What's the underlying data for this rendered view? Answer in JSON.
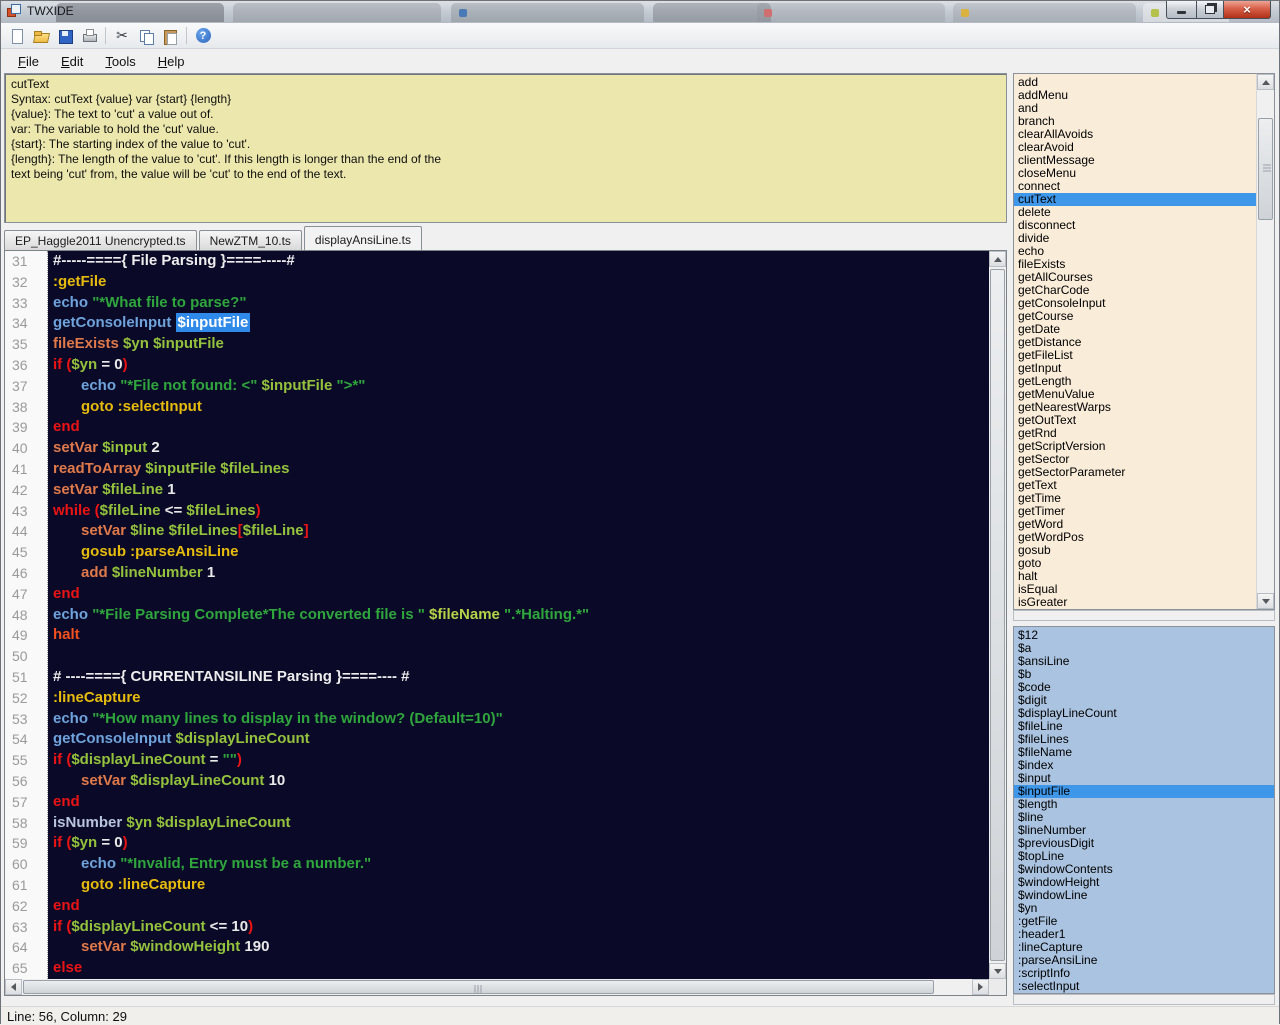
{
  "window": {
    "title": "TWXIDE"
  },
  "colors": {
    "help_bg": "#ece7ac",
    "cmd_bg": "#f9ecd9",
    "var_bg": "#aac3e0",
    "editor_bg": "#0a0a28",
    "row_sel_bg": "#3f97e9",
    "sel_bg": "#2f89e8",
    "sel_fg": "#ffffff",
    "hdr": "#ededed",
    "lbl": "#e7bb0e",
    "cmdB": "#6fa3dc",
    "cmdP": "#b9c4dd",
    "cmdO": "#e0794a",
    "halt": "#f2501e",
    "kw": "#ea1414",
    "var": "#94c23d",
    "varB": "#b6d348",
    "str": "#2fa63c",
    "lit": "#e9e9e9"
  },
  "toolbar": {
    "items": [
      {
        "name": "new-file-button",
        "icon": "new",
        "glyph": ""
      },
      {
        "name": "open-file-button",
        "icon": "open",
        "glyph": ""
      },
      {
        "name": "save-button",
        "icon": "save",
        "glyph": ""
      },
      {
        "name": "print-button",
        "icon": "print",
        "glyph": ""
      },
      {
        "sep": true
      },
      {
        "name": "cut-button",
        "icon": "cut",
        "glyph": "✂"
      },
      {
        "name": "copy-button",
        "icon": "copy",
        "glyph": ""
      },
      {
        "name": "paste-button",
        "icon": "paste",
        "glyph": ""
      },
      {
        "sep": true
      },
      {
        "name": "help-button",
        "icon": "help",
        "glyph": "?"
      }
    ]
  },
  "menu": {
    "items": [
      {
        "label": "File"
      },
      {
        "label": "Edit"
      },
      {
        "label": "Tools"
      },
      {
        "label": "Help"
      }
    ]
  },
  "help_pane": {
    "lines": [
      "cutText",
      "Syntax: cutText {value} var {start} {length}",
      "{value}: The text to 'cut' a value out of.",
      "var: The variable to hold the 'cut' value.",
      "{start}: The starting index of the value to 'cut'.",
      "{length}: The length of the value to 'cut'.  If this length is longer than the end of the",
      "text being 'cut' from, the value will be 'cut' to the end of the text."
    ]
  },
  "tabs": [
    {
      "label": "EP_Haggle2011 Unencrypted.ts",
      "active": false
    },
    {
      "label": "NewZTM_10.ts",
      "active": false
    },
    {
      "label": "displayAnsiLine.ts",
      "active": true
    }
  ],
  "editor": {
    "first_line": 31,
    "lines": [
      {
        "tokens": [
          [
            "hdr",
            "#-----===={ File Parsing }====-----#"
          ]
        ]
      },
      {
        "tokens": [
          [
            "lbl",
            ":getFile"
          ]
        ]
      },
      {
        "tokens": [
          [
            "cmdB",
            "echo "
          ],
          [
            "str",
            "\"*What file to parse?\""
          ]
        ]
      },
      {
        "tokens": [
          [
            "cmdB",
            "getConsoleInput "
          ],
          [
            "sel",
            "$inputFile"
          ]
        ]
      },
      {
        "tokens": [
          [
            "cmdO",
            "fileExists "
          ],
          [
            "var",
            "$yn "
          ],
          [
            "var",
            "$inputFile"
          ]
        ]
      },
      {
        "tokens": [
          [
            "kw",
            "if ("
          ],
          [
            "var",
            "$yn"
          ],
          [
            "lit",
            " = 0"
          ],
          [
            "kw",
            ")"
          ]
        ]
      },
      {
        "tokens": [
          [
            "ind",
            ""
          ],
          [
            "cmdB",
            "echo "
          ],
          [
            "str",
            "\"*File not found: <\" "
          ],
          [
            "var",
            "$inputFile"
          ],
          [
            "str",
            " \">*\""
          ]
        ]
      },
      {
        "tokens": [
          [
            "ind",
            ""
          ],
          [
            "lbl",
            "goto :selectInput"
          ]
        ]
      },
      {
        "tokens": [
          [
            "kw",
            "end"
          ]
        ]
      },
      {
        "tokens": [
          [
            "cmdO",
            "setVar "
          ],
          [
            "var",
            "$input"
          ],
          [
            "lit",
            " 2"
          ]
        ]
      },
      {
        "tokens": [
          [
            "cmdO",
            "readToArray "
          ],
          [
            "var",
            "$inputFile "
          ],
          [
            "var",
            "$fileLines"
          ]
        ]
      },
      {
        "tokens": [
          [
            "cmdO",
            "setVar "
          ],
          [
            "var",
            "$fileLine"
          ],
          [
            "lit",
            " 1"
          ]
        ]
      },
      {
        "tokens": [
          [
            "kw",
            "while ("
          ],
          [
            "var",
            "$fileLine"
          ],
          [
            "lit",
            " <= "
          ],
          [
            "var",
            "$fileLines"
          ],
          [
            "kw",
            ")"
          ]
        ]
      },
      {
        "tokens": [
          [
            "ind",
            ""
          ],
          [
            "cmdO",
            "setVar "
          ],
          [
            "var",
            "$line "
          ],
          [
            "var",
            "$fileLines"
          ],
          [
            "kw",
            "["
          ],
          [
            "var",
            "$fileLine"
          ],
          [
            "kw",
            "]"
          ]
        ]
      },
      {
        "tokens": [
          [
            "ind",
            ""
          ],
          [
            "lbl",
            "gosub :parseAnsiLine"
          ]
        ]
      },
      {
        "tokens": [
          [
            "ind",
            ""
          ],
          [
            "cmdO",
            "add "
          ],
          [
            "var",
            "$lineNumber"
          ],
          [
            "lit",
            " 1"
          ]
        ]
      },
      {
        "tokens": [
          [
            "kw",
            "end"
          ]
        ]
      },
      {
        "tokens": [
          [
            "cmdB",
            "echo "
          ],
          [
            "str",
            "\"*File Parsing Complete*The converted file is \" "
          ],
          [
            "varB",
            "$fileName"
          ],
          [
            "str",
            " \".*Halting.*\""
          ]
        ]
      },
      {
        "tokens": [
          [
            "halt",
            "halt"
          ]
        ]
      },
      {
        "tokens": []
      },
      {
        "tokens": [
          [
            "hdr",
            "# ----===={ CURRENTANSILINE Parsing }====---- #"
          ]
        ]
      },
      {
        "tokens": [
          [
            "lbl",
            ":lineCapture"
          ]
        ]
      },
      {
        "tokens": [
          [
            "cmdB",
            "echo "
          ],
          [
            "str",
            "\"*How many lines to display in the window? (Default=10)\""
          ]
        ]
      },
      {
        "tokens": [
          [
            "cmdB",
            "getConsoleInput "
          ],
          [
            "var",
            "$displayLineCount"
          ]
        ]
      },
      {
        "tokens": [
          [
            "kw",
            "if ("
          ],
          [
            "var",
            "$displayLineCount"
          ],
          [
            "lit",
            " = "
          ],
          [
            "str",
            "\"\""
          ],
          [
            "kw",
            ")"
          ]
        ]
      },
      {
        "tokens": [
          [
            "ind",
            ""
          ],
          [
            "cmdO",
            "setVar "
          ],
          [
            "var",
            "$displayLineCount"
          ],
          [
            "lit",
            " 10"
          ]
        ]
      },
      {
        "tokens": [
          [
            "kw",
            "end"
          ]
        ]
      },
      {
        "tokens": [
          [
            "cmdP",
            "isNumber "
          ],
          [
            "var",
            "$yn "
          ],
          [
            "var",
            "$displayLineCount"
          ]
        ]
      },
      {
        "tokens": [
          [
            "kw",
            "if ("
          ],
          [
            "var",
            "$yn"
          ],
          [
            "lit",
            " = 0"
          ],
          [
            "kw",
            ")"
          ]
        ]
      },
      {
        "tokens": [
          [
            "ind",
            ""
          ],
          [
            "cmdB",
            "echo "
          ],
          [
            "str",
            "\"*Invalid, Entry must be a number.\""
          ]
        ]
      },
      {
        "tokens": [
          [
            "ind",
            ""
          ],
          [
            "lbl",
            "goto :lineCapture"
          ]
        ]
      },
      {
        "tokens": [
          [
            "kw",
            "end"
          ]
        ]
      },
      {
        "tokens": [
          [
            "kw",
            "if ("
          ],
          [
            "var",
            "$displayLineCount"
          ],
          [
            "lit",
            " <= 10"
          ],
          [
            "kw",
            ")"
          ]
        ]
      },
      {
        "tokens": [
          [
            "ind",
            ""
          ],
          [
            "cmdO",
            "setVar "
          ],
          [
            "var",
            "$windowHeight"
          ],
          [
            "lit",
            " 190"
          ]
        ]
      },
      {
        "tokens": [
          [
            "kw",
            "else"
          ]
        ]
      }
    ]
  },
  "commands": {
    "selected": "cutText",
    "items": [
      "add",
      "addMenu",
      "and",
      "branch",
      "clearAllAvoids",
      "clearAvoid",
      "clientMessage",
      "closeMenu",
      "connect",
      "cutText",
      "delete",
      "disconnect",
      "divide",
      "echo",
      "fileExists",
      "getAllCourses",
      "getCharCode",
      "getConsoleInput",
      "getCourse",
      "getDate",
      "getDistance",
      "getFileList",
      "getInput",
      "getLength",
      "getMenuValue",
      "getNearestWarps",
      "getOutText",
      "getRnd",
      "getScriptVersion",
      "getSector",
      "getSectorParameter",
      "getText",
      "getTime",
      "getTimer",
      "getWord",
      "getWordPos",
      "gosub",
      "goto",
      "halt",
      "isEqual",
      "isGreater"
    ]
  },
  "variables": {
    "selected": "$inputFile",
    "items": [
      "$12",
      "$a",
      "$ansiLine",
      "$b",
      "$code",
      "$digit",
      "$displayLineCount",
      "$fileLine",
      "$fileLines",
      "$fileName",
      "$index",
      "$input",
      "$inputFile",
      "$length",
      "$line",
      "$lineNumber",
      "$previousDigit",
      "$topLine",
      "$windowContents",
      "$windowHeight",
      "$windowLine",
      "$yn",
      ":getFile",
      ":header1",
      ":lineCapture",
      ":parseAnsiLine",
      ":scriptInfo",
      ":selectInput"
    ]
  },
  "statusbar": {
    "text": "Line: 56, Column: 29"
  }
}
